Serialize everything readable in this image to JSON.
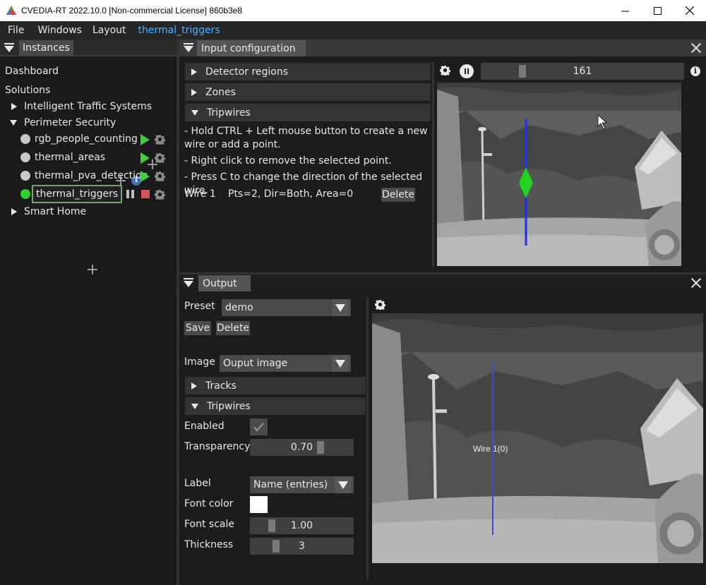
{
  "window": {
    "title": "CVEDIA-RT 2022.10.0    [Non-commercial License] 860b3e8"
  },
  "menu": {
    "items": [
      "File",
      "Windows",
      "Layout"
    ],
    "active_instance": "thermal_triggers"
  },
  "instances_panel": {
    "tab_label": "Instances",
    "dashboard": "Dashboard",
    "solutions_label": "Solutions",
    "solutions": [
      {
        "label": "Intelligent Traffic Systems",
        "expanded": false
      },
      {
        "label": "Perimeter Security",
        "expanded": true
      },
      {
        "label": "Smart Home",
        "expanded": false
      }
    ],
    "instances": [
      {
        "label": "rgb_people_counting",
        "status": "stopped"
      },
      {
        "label": "thermal_areas",
        "status": "stopped"
      },
      {
        "label": "thermal_pva_detection",
        "status": "stopped"
      },
      {
        "label": "thermal_triggers",
        "status": "running"
      }
    ],
    "colors": {
      "running": "#27d427",
      "stopped": "#c8c8c8",
      "play": "#3fcf3f",
      "stop": "#d25656"
    }
  },
  "input_config": {
    "tab_label": "Input configuration",
    "sections": {
      "detector_regions": "Detector regions",
      "zones": "Zones",
      "tripwires": "Tripwires"
    },
    "instructions": [
      "- Hold CTRL + Left mouse button to create a new wire or add a point.",
      "- Right click to remove the selected point.",
      "- Press C to change the direction of the selected wire."
    ],
    "wires": [
      {
        "name": "Wire 1",
        "details": "Pts=2, Dir=Both, Area=0",
        "delete_label": "Delete"
      }
    ],
    "frame_value": "161",
    "icons": [
      "gear-icon",
      "pause-icon",
      "info-icon"
    ]
  },
  "output": {
    "tab_label": "Output",
    "preset_label": "Preset",
    "preset_value": "demo",
    "save_label": "Save",
    "delete_label": "Delete",
    "image_label": "Image",
    "image_value": "Ouput image",
    "sections": {
      "tracks": "Tracks",
      "tripwires": "Tripwires"
    },
    "enabled_label": "Enabled",
    "enabled": true,
    "transparency_label": "Transparency",
    "transparency_value": "0.70",
    "label_label": "Label",
    "label_value": "Name (entries)",
    "font_color_label": "Font color",
    "font_color": "#ffffff",
    "font_scale_label": "Font scale",
    "font_scale_value": "1.00",
    "thickness_label": "Thickness",
    "thickness_value": "3",
    "overlay_text": "Wire 1(0)"
  },
  "colors": {
    "accent": "#4db1ff",
    "wire_blue": "#1a2ff0",
    "wire_green": "#22d322",
    "overlay_wire": "#3c4bd0"
  }
}
